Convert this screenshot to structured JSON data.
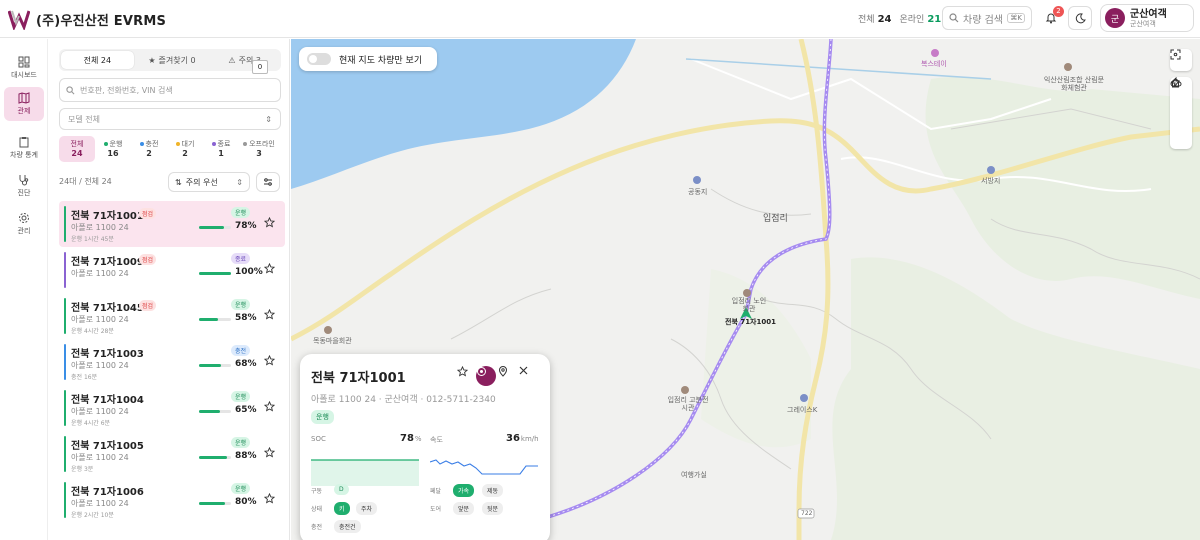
{
  "header": {
    "logo_text": "(주)우진산전 EVRMS",
    "stats": [
      {
        "label": "전체",
        "value": "24"
      },
      {
        "label": "온라인",
        "value": "21"
      }
    ],
    "search_placeholder": "차량 검색",
    "search_shortcut": "⌘K",
    "notification_count": "2",
    "user_initial": "군",
    "user_name": "군산여객",
    "user_role": "군산여객"
  },
  "nav": [
    {
      "label": "대시보드",
      "icon": "dashboard-icon"
    },
    {
      "label": "관제",
      "icon": "map-icon",
      "active": true
    },
    {
      "label": "차량 통계",
      "icon": "clipboard-icon"
    },
    {
      "label": "진단",
      "icon": "stethoscope-icon"
    },
    {
      "label": "관리",
      "icon": "gear-icon"
    }
  ],
  "sidebar": {
    "tabs": [
      {
        "label": "전체 24",
        "active": true
      },
      {
        "label": "즐겨찾기 0"
      },
      {
        "label": "주의 3"
      }
    ],
    "tooltip": "0",
    "search_placeholder": "번호판, 전화번호, VIN 검색",
    "model_placeholder": "모델 전체",
    "filters": [
      {
        "label": "전체",
        "count": "24",
        "active": true,
        "color": ""
      },
      {
        "label": "운행",
        "count": "16",
        "color": "#1fae6e"
      },
      {
        "label": "충전",
        "count": "2",
        "color": "#3a8ee6"
      },
      {
        "label": "대기",
        "count": "2",
        "color": "#f0b429"
      },
      {
        "label": "종료",
        "count": "1",
        "color": "#8a63d2"
      },
      {
        "label": "오프라인",
        "count": "3",
        "color": "#999999"
      }
    ],
    "count_text": "24대 / 전체 24",
    "sort_label": "주의 우선",
    "vehicles": [
      {
        "plate": "전북 71자1001",
        "tag": "점검",
        "model": "아폴로 1100 24",
        "sub": "운행 1시간 45분",
        "status": "운행",
        "pct": "78%",
        "level": 0.78,
        "color": "#1fae6e",
        "selected": true
      },
      {
        "plate": "전북 71자1009",
        "tag": "점검",
        "model": "아폴로 1100 24",
        "sub": "",
        "status": "종료",
        "pct": "100%",
        "level": 1.0,
        "color": "#8a63d2"
      },
      {
        "plate": "전북 71자1045",
        "tag": "점검",
        "model": "아폴로 1100 24",
        "sub": "운행 4시간 28분",
        "status": "운행",
        "pct": "58%",
        "level": 0.58,
        "color": "#1fae6e"
      },
      {
        "plate": "전북 71자1003",
        "tag": "",
        "model": "아폴로 1100 24",
        "sub": "충전 16분",
        "status": "충전",
        "pct": "68%",
        "level": 0.68,
        "color": "#3a8ee6"
      },
      {
        "plate": "전북 71자1004",
        "tag": "",
        "model": "아폴로 1100 24",
        "sub": "운행 4시간 6분",
        "status": "운행",
        "pct": "65%",
        "level": 0.65,
        "color": "#1fae6e"
      },
      {
        "plate": "전북 71자1005",
        "tag": "",
        "model": "아폴로 1100 24",
        "sub": "운행 3분",
        "status": "운행",
        "pct": "88%",
        "level": 0.88,
        "color": "#1fae6e"
      },
      {
        "plate": "전북 71자1006",
        "tag": "",
        "model": "아폴로 1100 24",
        "sub": "운행 2시간 10분",
        "status": "운행",
        "pct": "80%",
        "level": 0.8,
        "color": "#1fae6e"
      }
    ]
  },
  "map": {
    "toggle_label": "현재 지도 차량만 보기",
    "labels": [
      {
        "text": "복스테이"
      },
      {
        "text": "익산산림조합 산림문화체험관"
      },
      {
        "text": "서방지"
      },
      {
        "text": "공동지"
      },
      {
        "text": "입점리"
      },
      {
        "text": "입점리 노인회관"
      },
      {
        "text": "전북 71자1001"
      },
      {
        "text": "목동마을회관"
      },
      {
        "text": "입점리 고분전시관"
      },
      {
        "text": "그레이스K"
      },
      {
        "text": "여행가실"
      },
      {
        "text": "722"
      }
    ]
  },
  "popup": {
    "title": "전북 71자1001",
    "subtitle": "아폴로 1100 24 · 군산여객 · 012-5711-2340",
    "badge": "운행",
    "soc_label": "SOC",
    "soc_value": "78",
    "soc_unit": "%",
    "speed_label": "속도",
    "speed_value": "36",
    "speed_unit": "km/h",
    "rows": {
      "drive_label": "구동",
      "drive_value": "D",
      "pedal_label": "페달",
      "pedal_accel": "가속",
      "pedal_brake": "제동",
      "state_label": "상태",
      "state_on": "키",
      "state_park": "주차",
      "door_label": "도어",
      "door_front": "앞문",
      "door_rear": "뒷문",
      "charge_label": "충전",
      "charge_value": "충전건"
    }
  }
}
